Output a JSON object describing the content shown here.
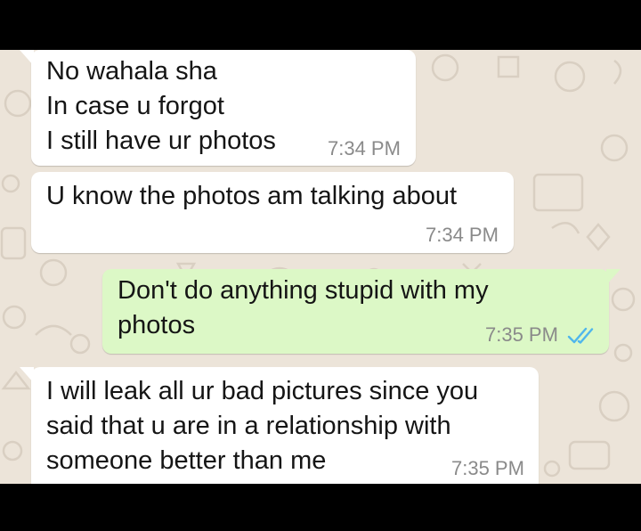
{
  "colors": {
    "wallpaper": "#ece4d9",
    "incoming_bubble": "#ffffff",
    "outgoing_bubble": "#dcf8c6",
    "timestamp": "#8a8a8a",
    "read_ticks": "#4fb6ec"
  },
  "messages": [
    {
      "direction": "incoming",
      "lines": [
        "No wahala sha",
        "In case u forgot",
        "I still have ur photos"
      ],
      "time": "7:34 PM"
    },
    {
      "direction": "incoming",
      "lines": [
        "U know the photos am talking about"
      ],
      "time": "7:34 PM"
    },
    {
      "direction": "outgoing",
      "lines": [
        "Don't do anything stupid with my",
        "photos"
      ],
      "time": "7:35 PM",
      "status_icon": "double-check-read-icon"
    },
    {
      "direction": "incoming",
      "lines": [
        "I will leak all ur bad pictures since you",
        "said that u are in a relationship with",
        "someone better than me"
      ],
      "time": "7:35 PM"
    }
  ]
}
